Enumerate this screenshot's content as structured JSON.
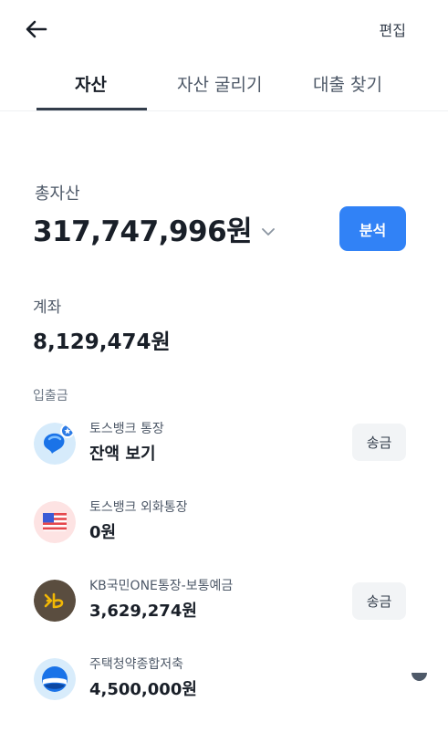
{
  "header": {
    "edit_label": "편집"
  },
  "tabs": [
    {
      "label": "자산",
      "active": true
    },
    {
      "label": "자산 굴리기",
      "active": false
    },
    {
      "label": "대출 찾기",
      "active": false
    }
  ],
  "total": {
    "label": "총자산",
    "value": "317,747,996원",
    "analyze_label": "분석"
  },
  "accounts": {
    "label": "계좌",
    "value": "8,129,474원",
    "sub_label": "입출금",
    "items": [
      {
        "name": "토스뱅크 통장",
        "amount": "잔액 보기",
        "action": "송금",
        "icon": "toss-bank-icon"
      },
      {
        "name": "토스뱅크 외화통장",
        "amount": "0원",
        "action": "",
        "icon": "us-flag-icon"
      },
      {
        "name": "KB국민ONE통장-보통예금",
        "amount": "3,629,274원",
        "action": "송금",
        "icon": "kb-bank-icon"
      },
      {
        "name": "주택청약종합저축",
        "amount": "4,500,000원",
        "action": "",
        "icon": "housing-savings-icon"
      }
    ]
  },
  "colors": {
    "primary": "#3182f6",
    "text": "#191f28",
    "subtext": "#4e5968",
    "button_bg": "#f2f4f6"
  }
}
